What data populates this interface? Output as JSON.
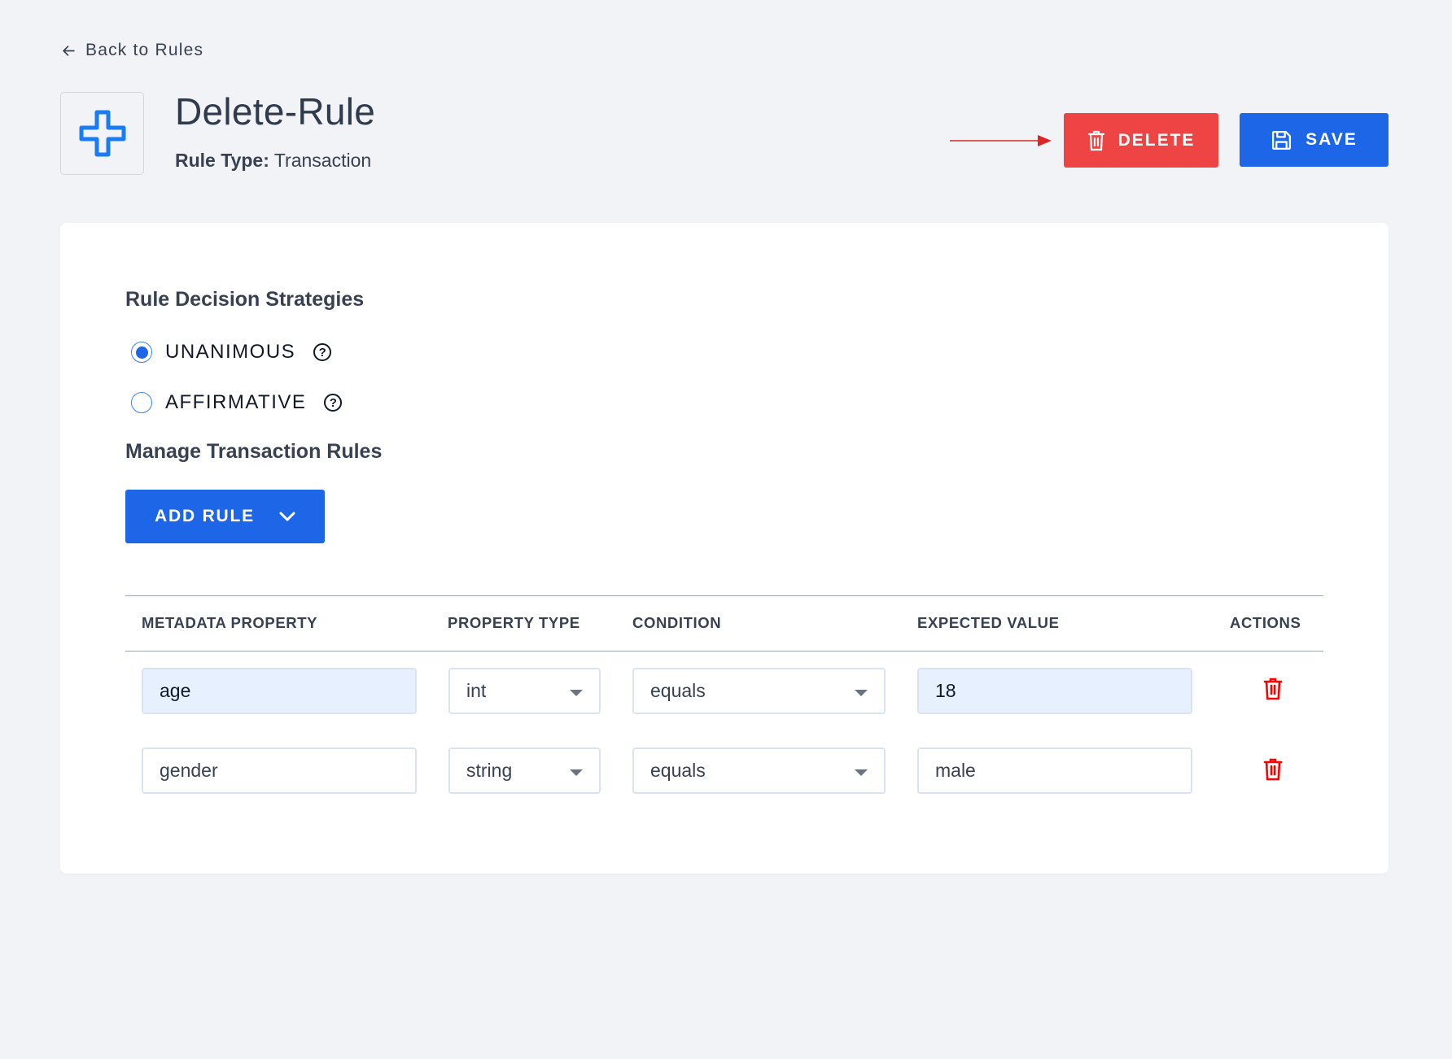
{
  "back_link": {
    "label": "Back to Rules",
    "icon": "arrow-left-icon"
  },
  "header": {
    "icon": "plus-outline-icon",
    "title": "Delete-Rule",
    "rule_type_label": "Rule Type:",
    "rule_type_value": "Transaction"
  },
  "actions": {
    "delete_label": "DELETE",
    "save_label": "SAVE",
    "colors": {
      "delete": "#ef4444",
      "save": "#1d66e8",
      "annotation_arrow": "#dc2626"
    }
  },
  "strategies": {
    "heading": "Rule Decision Strategies",
    "options": [
      {
        "label": "UNANIMOUS",
        "selected": true,
        "help": "?"
      },
      {
        "label": "AFFIRMATIVE",
        "selected": false,
        "help": "?"
      }
    ]
  },
  "manage": {
    "heading": "Manage Transaction Rules",
    "add_rule_label": "ADD RULE"
  },
  "table": {
    "columns": [
      "METADATA PROPERTY",
      "PROPERTY TYPE",
      "CONDITION",
      "EXPECTED VALUE",
      "ACTIONS"
    ],
    "rows": [
      {
        "property": "age",
        "type": "int",
        "condition": "equals",
        "expected": "18"
      },
      {
        "property": "gender",
        "type": "string",
        "condition": "equals",
        "expected": "male"
      }
    ]
  }
}
